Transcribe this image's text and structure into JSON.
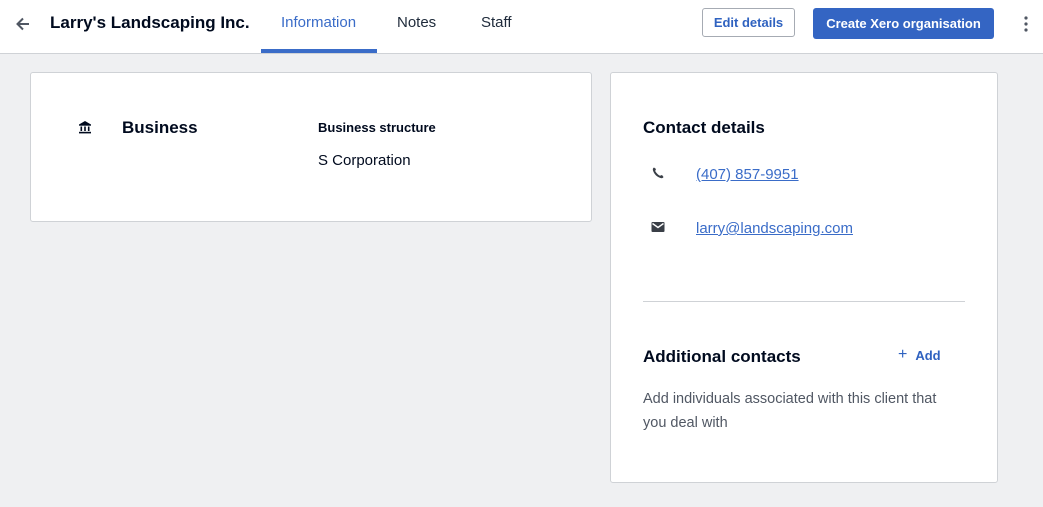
{
  "header": {
    "back_icon": "arrow-left-icon",
    "title": "Larry's Landscaping Inc.",
    "tabs": [
      {
        "label": "Information",
        "active": true
      },
      {
        "label": "Notes",
        "active": false
      },
      {
        "label": "Staff",
        "active": false
      }
    ],
    "edit_label": "Edit details",
    "create_label": "Create Xero organisation",
    "more_icon": "kebab-menu-icon",
    "accent_color": "#3465c3"
  },
  "business": {
    "icon": "bank-icon",
    "title": "Business",
    "structure_label": "Business structure",
    "structure_value": "S Corporation"
  },
  "contact": {
    "title": "Contact details",
    "phone_icon": "phone-icon",
    "phone": "(407) 857-9951",
    "email_icon": "envelope-icon",
    "email": "larry@landscaping.com"
  },
  "additional": {
    "title": "Additional contacts",
    "add_label": "Add",
    "add_icon": "plus-icon",
    "description": "Add individuals associated with this client that you deal with"
  }
}
